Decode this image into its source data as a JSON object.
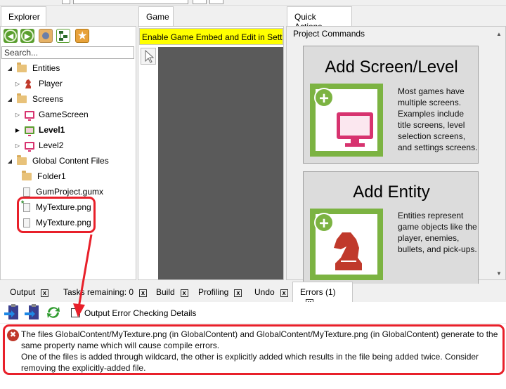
{
  "explorer": {
    "tab_label": "Explorer",
    "search_placeholder": "Search...",
    "toolbar_icons": [
      "back-arrow-icon",
      "forward-arrow-icon",
      "collapse-icon",
      "add-file-icon",
      "star-icon"
    ],
    "tree": [
      {
        "label": "Entities",
        "type": "folder",
        "depth": 0,
        "expanded": true
      },
      {
        "label": "Player",
        "type": "entity",
        "depth": 1,
        "expanded": false
      },
      {
        "label": "Screens",
        "type": "folder",
        "depth": 0,
        "expanded": true
      },
      {
        "label": "GameScreen",
        "type": "screen",
        "depth": 1,
        "expanded": false
      },
      {
        "label": "Level1",
        "type": "screen-start",
        "depth": 1,
        "expanded": false,
        "bold": true
      },
      {
        "label": "Level2",
        "type": "screen",
        "depth": 1,
        "expanded": false
      },
      {
        "label": "Global Content Files",
        "type": "folder",
        "depth": 0,
        "expanded": true
      },
      {
        "label": "Folder1",
        "type": "folder",
        "depth": 1
      },
      {
        "label": "GumProject.gumx",
        "type": "file",
        "depth": 1
      },
      {
        "label": "MyTexture.png",
        "type": "file-wildcard",
        "depth": 1
      },
      {
        "label": "MyTexture.png",
        "type": "file",
        "depth": 1
      }
    ]
  },
  "game": {
    "tab_label": "Game",
    "banner": "Enable Game Embed and Edit in Settings"
  },
  "quick_actions": {
    "tab_label": "Quick Actions",
    "section_title": "Project Commands",
    "cards": [
      {
        "title": "Add Screen/Level",
        "description": "Most games have multiple screens. Examples include title screens, level selection screens, and settings screens.",
        "icon": "screen-icon"
      },
      {
        "title": "Add Entity",
        "description": "Entities represent game objects like the player, enemies, bullets, and pick-ups.",
        "icon": "chess-knight-icon"
      }
    ]
  },
  "bottom_tabs": [
    {
      "label": "Output",
      "closable": true
    },
    {
      "label": "Tasks remaining: 0",
      "closable": true
    },
    {
      "label": "Build",
      "closable": true
    },
    {
      "label": "Profiling",
      "closable": true
    },
    {
      "label": "Undo",
      "closable": true
    },
    {
      "label": "Errors (1)",
      "closable": true,
      "active": true
    }
  ],
  "errors": {
    "checkbox_label": "Output Error Checking Details",
    "checkbox_checked": false,
    "message_line1": "The files GlobalContent/MyTexture.png (in GlobalContent) and GlobalContent/MyTexture.png (in GlobalContent) generate to the same property name which will cause compile errors.",
    "message_line2": "One of the files is added through wildcard, the other is explicitly added which results in the file being added twice. Consider removing the explicitly-added file."
  },
  "colors": {
    "highlight": "#e8202a",
    "accent_green": "#7cb342",
    "screen_pink": "#d7336f",
    "banner_yellow": "#ffff00"
  }
}
